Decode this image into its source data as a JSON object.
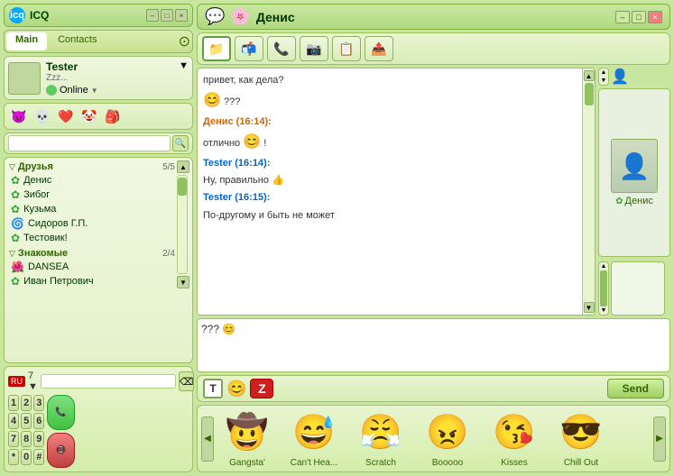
{
  "app": {
    "title": "ICQ",
    "logo": "icq"
  },
  "header": {
    "min": "–",
    "max": "□",
    "close": "×"
  },
  "tabs": {
    "main": "Main",
    "contacts": "Contacts"
  },
  "user": {
    "name": "Tester",
    "status_text": "Zzz...",
    "status": "Online",
    "arrow": "▼"
  },
  "moods": [
    "😈",
    "💀",
    "❤️",
    "🤡",
    "🎒"
  ],
  "search": {
    "placeholder": "",
    "icon": "🔍"
  },
  "groups": {
    "friends": {
      "label": "Друзья",
      "count": "5/5",
      "contacts": [
        "Денис",
        "Зибог",
        "Кузьма",
        "Сидоров Г.П.",
        "Тестовик!"
      ]
    },
    "acquaintances": {
      "label": "Знакомые",
      "count": "2/4",
      "contacts": [
        "DANSEA",
        "Иван Петрович"
      ]
    }
  },
  "phone": {
    "code": "7",
    "flag": "RU",
    "keys": [
      "1",
      "2",
      "3",
      "4",
      "5",
      "6",
      "7",
      "8",
      "9",
      "*",
      "0",
      "#"
    ],
    "extra_key": "⌫",
    "call_icon": "📞",
    "end_icon": "📵"
  },
  "chat": {
    "title": "Денис",
    "icon": "💬",
    "toolbar_icons": [
      "📁",
      "📬",
      "📞",
      "📷",
      "📋",
      "📤"
    ],
    "messages": [
      {
        "type": "plain",
        "text": "привет, как дела?"
      },
      {
        "type": "emote",
        "text": "??? "
      },
      {
        "type": "sender",
        "name": "Денис (16:14):",
        "color": "orange"
      },
      {
        "type": "plain",
        "text": "отлично "
      },
      {
        "type": "emote",
        "text": "😊 !"
      },
      {
        "type": "sender",
        "name": "Tester (16:14):",
        "color": "blue"
      },
      {
        "type": "plain",
        "text": "Ну, правильно 👍"
      },
      {
        "type": "sender",
        "name": "Tester (16:15):",
        "color": "blue"
      },
      {
        "type": "plain",
        "text": "По-другому и быть не может"
      }
    ],
    "input_text": "??? 😊",
    "format_bold": "T",
    "emoji_label": "😊",
    "z_label": "Z",
    "send_label": "Send",
    "avatar_name": "Денис"
  },
  "emoticons": {
    "arrow_left": "◀",
    "arrow_right": "▶",
    "items": [
      {
        "emoji": "🤠",
        "label": "Gangsta'"
      },
      {
        "emoji": "😅",
        "label": "Can't Hea..."
      },
      {
        "emoji": "😤",
        "label": "Scratch"
      },
      {
        "emoji": "😠",
        "label": "Booooo"
      },
      {
        "emoji": "😘",
        "label": "Kisses"
      },
      {
        "emoji": "😎",
        "label": "Chill Out"
      }
    ]
  }
}
